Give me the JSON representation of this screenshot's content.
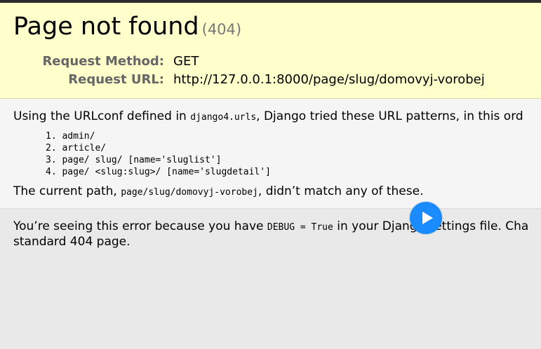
{
  "summary": {
    "title": "Page not found",
    "status_code": "(404)",
    "request_method_label": "Request Method:",
    "request_method_value": "GET",
    "request_url_label": "Request URL:",
    "request_url_value": "http://127.0.0.1:8000/page/slug/domovyj-vorobej"
  },
  "info": {
    "intro_before": "Using the URLconf defined in ",
    "urlconf": "django4.urls",
    "intro_after": ", Django tried these URL patterns, in this ord",
    "patterns": [
      "1. admin/",
      "2. article/",
      "3. page/ slug/ [name='sluglist']",
      "4. page/ <slug:slug>/ [name='slugdetail']"
    ],
    "current_before": "The current path, ",
    "current_path": "page/slug/domovyj-vorobej",
    "current_after": ", didn’t match any of these."
  },
  "explanation": {
    "line1_before": "You’re seeing this error because you have ",
    "debug_code": "DEBUG = True",
    "line1_after": " in your Django settings file. Cha",
    "line2": "standard 404 page."
  },
  "overlay": {
    "play_icon": "play-icon",
    "play_color": "#1a8cff"
  }
}
